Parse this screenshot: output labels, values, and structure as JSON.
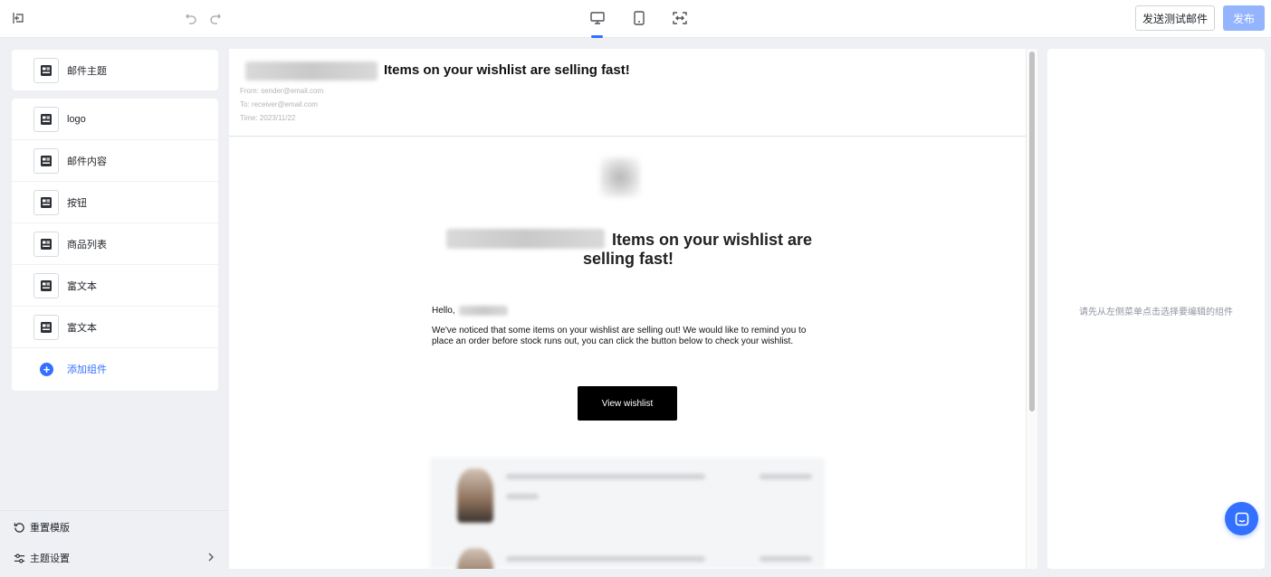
{
  "toolbar": {
    "test_email_label": "发送测试邮件",
    "publish_label": "发布",
    "accent_color": "#3370ff"
  },
  "sidebar": {
    "subject_item": {
      "label": "邮件主题",
      "icon": "layout-icon"
    },
    "items": [
      {
        "label": "logo",
        "icon": "layout-icon"
      },
      {
        "label": "邮件内容",
        "icon": "layout-icon"
      },
      {
        "label": "按钮",
        "icon": "layout-icon"
      },
      {
        "label": "商品列表",
        "icon": "layout-icon"
      },
      {
        "label": "富文本",
        "icon": "layout-icon"
      },
      {
        "label": "富文本",
        "icon": "layout-icon"
      }
    ],
    "add_component_label": "添加组件",
    "reset_template_label": "重置模版",
    "theme_settings_label": "主题设置"
  },
  "preview": {
    "subject": "Items on your wishlist are selling fast!",
    "from": "From: sender@email.com",
    "to": "To: receiver@email.com",
    "time": "Time: 2023/11/22",
    "title_line1": "Items on your wishlist are",
    "title_line2": "selling fast!",
    "greeting": "Hello,",
    "body": "We've noticed that some items on your wishlist are selling out! We would like to remind you to place an order before stock runs out, you can click the button below to check your wishlist.",
    "button_label": "View wishlist"
  },
  "right_panel": {
    "hint": "请先从左侧菜单点击选择要编辑的组件"
  }
}
